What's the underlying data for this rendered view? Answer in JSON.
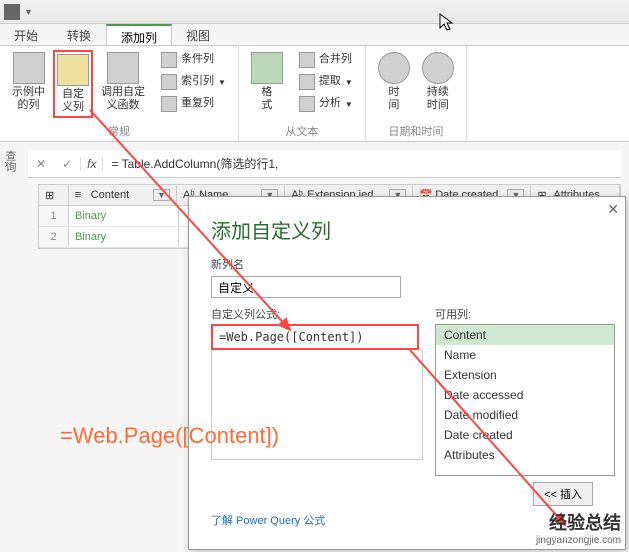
{
  "tabs": {
    "t1": "开始",
    "t2": "转换",
    "t3": "添加列",
    "t4": "视图"
  },
  "ribbon": {
    "g1": {
      "label": "常规",
      "b1": "示例中\n的列",
      "b2": "自定\n义列",
      "b3": "调用自定\n义函数",
      "b4": "条件列",
      "b5": "索引列",
      "b6": "重复列"
    },
    "g2": {
      "label": "从文本",
      "b1": "格\n式",
      "b2": "合并列",
      "b3": "提取",
      "b4": "分析"
    },
    "g3": {
      "label": "日期和时间",
      "b1": "时\n间",
      "b2": "持续\n时间"
    }
  },
  "formula_bar": {
    "x": "✕",
    "chk": "✓",
    "fx": "fx",
    "text": "= Table.AddColumn(筛选的行1,"
  },
  "side_label": "查询",
  "grid": {
    "head": {
      "c1": "Content",
      "c2": "Name",
      "c3": "Extension ied",
      "c4": "Date created",
      "c5": "Attributes"
    },
    "rows": [
      {
        "n": "1",
        "c1": "Binary"
      },
      {
        "n": "2",
        "c1": "Binary"
      }
    ]
  },
  "dialog": {
    "title": "添加自定义列",
    "label_name": "新列名",
    "name_value": "自定义",
    "label_formula": "自定义列公式:",
    "formula_value": "=Web.Page([Content])",
    "label_cols": "可用列:",
    "cols": [
      "Content",
      "Name",
      "Extension",
      "Date accessed",
      "Date modified",
      "Date created",
      "Attributes"
    ],
    "insert": "<< 插入",
    "link": "了解 Power Query 公式"
  },
  "annotation": "=Web.Page([Content])",
  "watermark": {
    "cn": "经验总结",
    "en": "jingyanzongjie.com"
  }
}
